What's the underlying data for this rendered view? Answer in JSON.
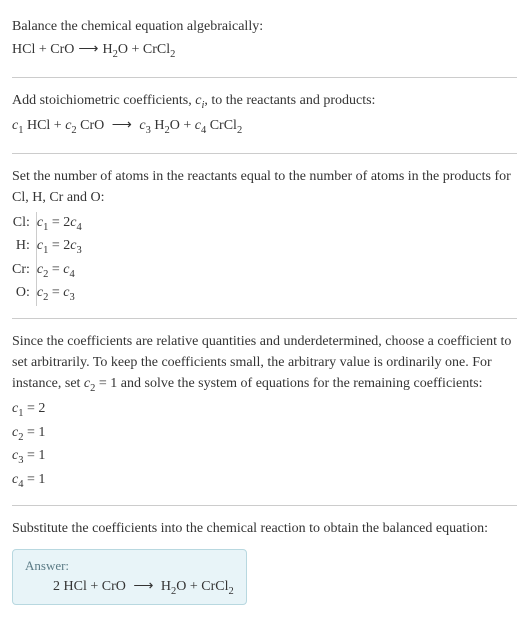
{
  "section1": {
    "title": "Balance the chemical equation algebraically:",
    "eq": {
      "lhs1": "HCl",
      "plus": " + ",
      "lhs2": "CrO",
      "arrow": "⟶",
      "rhs1a": "H",
      "rhs1sub": "2",
      "rhs1b": "O",
      "rhs2a": "CrCl",
      "rhs2sub": "2"
    }
  },
  "section2": {
    "title_a": "Add stoichiometric coefficients, ",
    "title_ci": "c",
    "title_i": "i",
    "title_b": ", to the reactants and products:",
    "eq": {
      "c1": "c",
      "c1sub": "1",
      "sp1": " HCl + ",
      "c2": "c",
      "c2sub": "2",
      "sp2": " CrO ",
      "arrow": "⟶",
      "sp3": " ",
      "c3": "c",
      "c3sub": "3",
      "sp4": " H",
      "h2sub": "2",
      "sp5": "O + ",
      "c4": "c",
      "c4sub": "4",
      "sp6": " CrCl",
      "cl2sub": "2"
    }
  },
  "section3": {
    "title": "Set the number of atoms in the reactants equal to the number of atoms in the products for Cl, H, Cr and O:",
    "rows": [
      {
        "label": "Cl:",
        "lhs_c": "c",
        "lhs_sub": "1",
        "eq": " = 2",
        "rhs_c": "c",
        "rhs_sub": "4"
      },
      {
        "label": "H:",
        "lhs_c": "c",
        "lhs_sub": "1",
        "eq": " = 2",
        "rhs_c": "c",
        "rhs_sub": "3"
      },
      {
        "label": "Cr:",
        "lhs_c": "c",
        "lhs_sub": "2",
        "eq": " = ",
        "rhs_c": "c",
        "rhs_sub": "4"
      },
      {
        "label": "O:",
        "lhs_c": "c",
        "lhs_sub": "2",
        "eq": " = ",
        "rhs_c": "c",
        "rhs_sub": "3"
      }
    ]
  },
  "section4": {
    "text_a": "Since the coefficients are relative quantities and underdetermined, choose a coefficient to set arbitrarily. To keep the coefficients small, the arbitrary value is ordinarily one. For instance, set ",
    "c2": "c",
    "c2sub": "2",
    "text_b": " = 1 and solve the system of equations for the remaining coefficients:",
    "coefs": [
      {
        "c": "c",
        "sub": "1",
        "eq": " = 2"
      },
      {
        "c": "c",
        "sub": "2",
        "eq": " = 1"
      },
      {
        "c": "c",
        "sub": "3",
        "eq": " = 1"
      },
      {
        "c": "c",
        "sub": "4",
        "eq": " = 1"
      }
    ]
  },
  "section5": {
    "title": "Substitute the coefficients into the chemical reaction to obtain the balanced equation:",
    "answer_label": "Answer:",
    "eq": {
      "lhs": "2 HCl + CrO ",
      "arrow": "⟶",
      "rhs_a": " H",
      "h2sub": "2",
      "rhs_b": "O + CrCl",
      "cl2sub": "2"
    }
  }
}
